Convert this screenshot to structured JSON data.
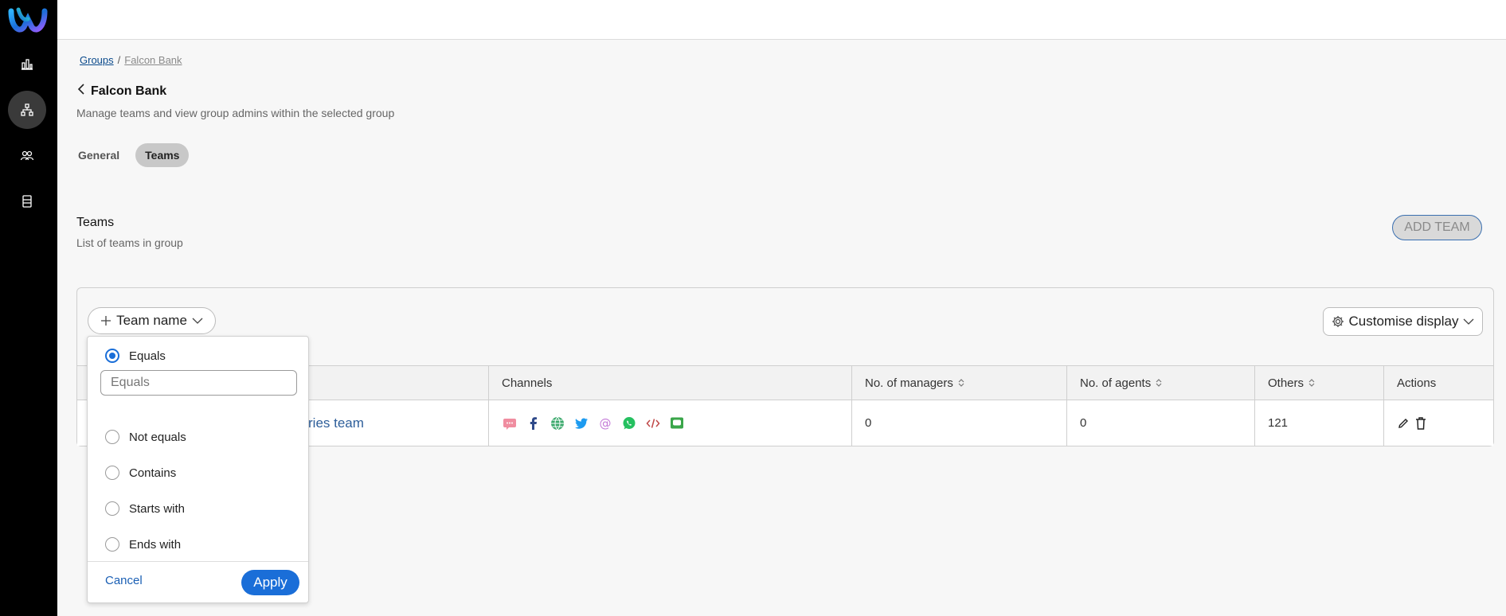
{
  "sidebar": {
    "items": [
      {
        "icon": "analytics-icon"
      },
      {
        "icon": "hierarchy-icon",
        "active": true
      },
      {
        "icon": "users-icon"
      },
      {
        "icon": "data-icon"
      }
    ]
  },
  "breadcrumb": {
    "root": "Groups",
    "separator": "/",
    "current": "Falcon Bank"
  },
  "page": {
    "title": "Falcon Bank",
    "subtitle": "Manage teams and view group admins within the selected group"
  },
  "tabs": [
    {
      "label": "General",
      "active": false
    },
    {
      "label": "Teams",
      "active": true
    }
  ],
  "section": {
    "title": "Teams",
    "subtitle": "List of teams in group",
    "add_button": "ADD TEAM"
  },
  "toolbar": {
    "filter_chip": "Team name",
    "customise": "Customise display"
  },
  "table": {
    "headers": {
      "channels": "Channels",
      "managers": "No. of managers",
      "agents": "No. of agents",
      "others": "Others",
      "actions": "Actions"
    },
    "rows": [
      {
        "team_partial": "ries team",
        "channels": [
          "sms-icon",
          "facebook-icon",
          "web-icon",
          "twitter-icon",
          "email-icon",
          "whatsapp-icon",
          "code-icon",
          "chat-icon"
        ],
        "managers": "0",
        "agents": "0",
        "others": "121"
      }
    ]
  },
  "filter_popover": {
    "options": [
      {
        "label": "Equals",
        "checked": true
      },
      {
        "label": "Not equals",
        "checked": false
      },
      {
        "label": "Contains",
        "checked": false
      },
      {
        "label": "Starts with",
        "checked": false
      },
      {
        "label": "Ends with",
        "checked": false
      }
    ],
    "input_placeholder": "Equals",
    "cancel": "Cancel",
    "apply": "Apply"
  },
  "colors": {
    "accent": "#1a6ed8",
    "sidebar_bg": "#000000",
    "link": "#2d5e9a"
  }
}
